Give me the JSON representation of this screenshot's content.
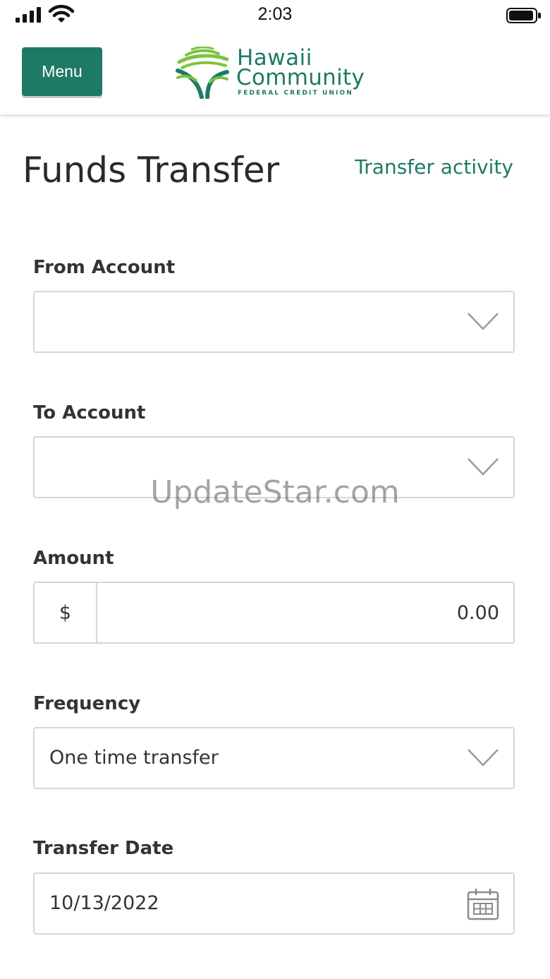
{
  "status_bar": {
    "time": "2:03"
  },
  "header": {
    "menu_label": "Menu",
    "logo": {
      "line1": "Hawaii",
      "line2": "Community",
      "subtitle": "FEDERAL CREDIT UNION"
    }
  },
  "page": {
    "title": "Funds Transfer",
    "activity_link": "Transfer activity"
  },
  "form": {
    "from_account": {
      "label": "From Account",
      "value": ""
    },
    "to_account": {
      "label": "To Account",
      "value": ""
    },
    "amount": {
      "label": "Amount",
      "currency_symbol": "$",
      "value": "0.00"
    },
    "frequency": {
      "label": "Frequency",
      "value": "One time transfer"
    },
    "transfer_date": {
      "label": "Transfer Date",
      "value": "10/13/2022"
    }
  },
  "watermark": "UpdateStar.com",
  "colors": {
    "brand_green": "#1e7a64",
    "logo_light_green": "#7cc242",
    "border": "#d6d6d6"
  },
  "icons": [
    "signal-icon",
    "wifi-icon",
    "battery-icon",
    "chevron-down-icon",
    "calendar-icon",
    "logo-tree-icon"
  ]
}
